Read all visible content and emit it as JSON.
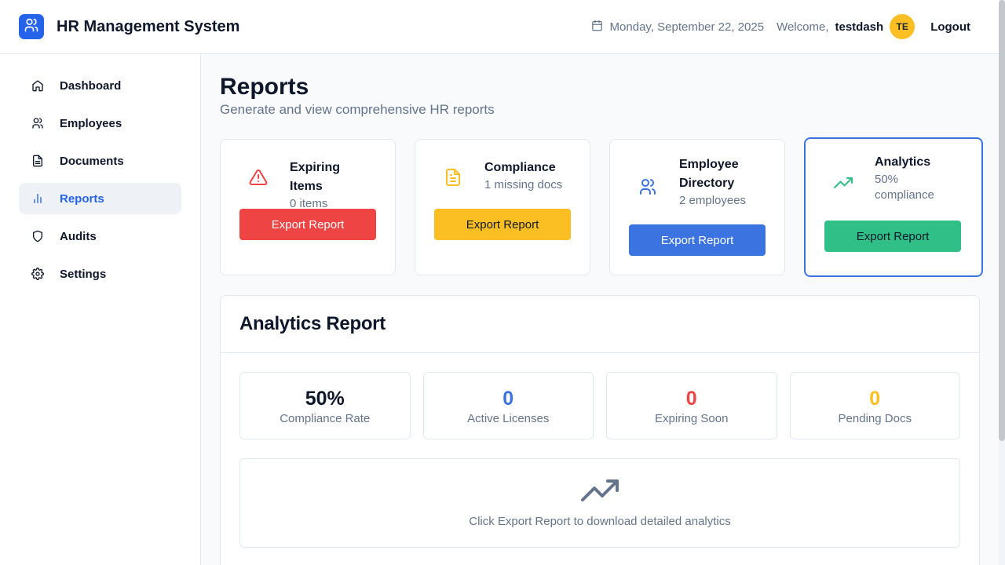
{
  "app": {
    "title": "HR Management System",
    "logo_icon": "users-icon"
  },
  "header": {
    "date": "Monday, September 22, 2025",
    "welcome_label": "Welcome,",
    "username": "testdash",
    "avatar_initials": "TE",
    "logout_label": "Logout"
  },
  "sidebar": {
    "items": [
      {
        "label": "Dashboard",
        "icon": "home-icon",
        "active": false
      },
      {
        "label": "Employees",
        "icon": "users-icon",
        "active": false
      },
      {
        "label": "Documents",
        "icon": "document-icon",
        "active": false
      },
      {
        "label": "Reports",
        "icon": "bar-chart-icon",
        "active": true
      },
      {
        "label": "Audits",
        "icon": "shield-icon",
        "active": false
      },
      {
        "label": "Settings",
        "icon": "gear-icon",
        "active": false
      }
    ]
  },
  "page": {
    "title": "Reports",
    "subtitle": "Generate and view comprehensive HR reports"
  },
  "report_cards": [
    {
      "title": "Expiring Items",
      "subtitle": "0 items",
      "button": "Export Report",
      "icon": "alert-triangle-icon",
      "color": "#ef4444"
    },
    {
      "title": "Compliance",
      "subtitle": "1 missing docs",
      "button": "Export Report",
      "icon": "file-text-icon",
      "color": "#fbbf24"
    },
    {
      "title": "Employee Directory",
      "subtitle": "2 employees",
      "button": "Export Report",
      "icon": "users-icon",
      "color": "#3b73e0"
    },
    {
      "title": "Analytics",
      "subtitle": "50% compliance",
      "button": "Export Report",
      "icon": "trending-up-icon",
      "color": "#2fbf87",
      "selected": true
    }
  ],
  "analytics_report": {
    "title": "Analytics Report",
    "stats": [
      {
        "value": "50%",
        "label": "Compliance Rate",
        "color": "#0f172a"
      },
      {
        "value": "0",
        "label": "Active Licenses",
        "color": "#3b73e0"
      },
      {
        "value": "0",
        "label": "Expiring Soon",
        "color": "#ef4444"
      },
      {
        "value": "0",
        "label": "Pending Docs",
        "color": "#fbbf24"
      }
    ],
    "message": "Click Export Report to download detailed analytics",
    "message_icon": "trending-up-icon"
  }
}
